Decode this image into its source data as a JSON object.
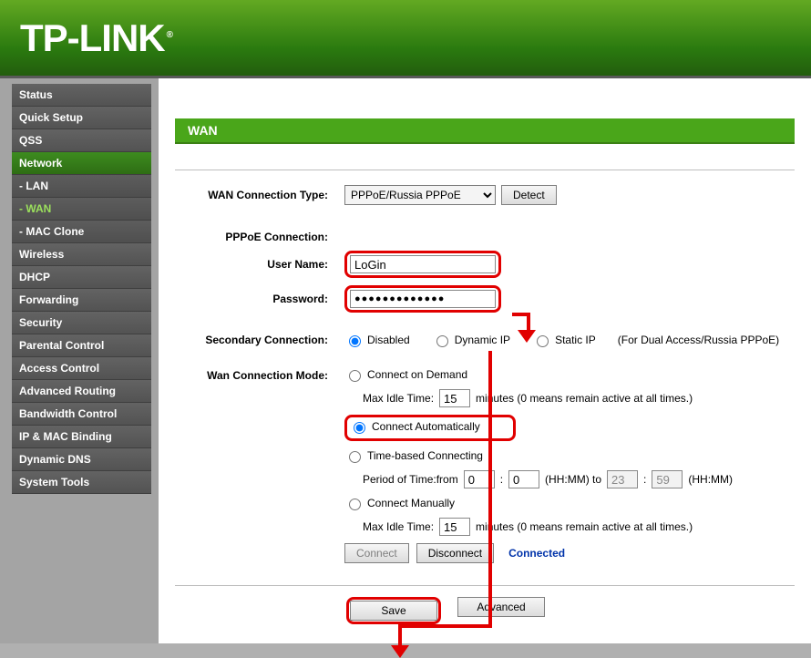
{
  "header": {
    "logo": "TP-LINK"
  },
  "sidebar": {
    "items": [
      {
        "label": "Status",
        "selected": false,
        "sub": false,
        "active": false
      },
      {
        "label": "Quick Setup",
        "selected": false,
        "sub": false,
        "active": false
      },
      {
        "label": "QSS",
        "selected": false,
        "sub": false,
        "active": false
      },
      {
        "label": "Network",
        "selected": true,
        "sub": false,
        "active": false
      },
      {
        "label": "- LAN",
        "selected": false,
        "sub": true,
        "active": false
      },
      {
        "label": "- WAN",
        "selected": false,
        "sub": true,
        "active": true
      },
      {
        "label": "- MAC Clone",
        "selected": false,
        "sub": true,
        "active": false
      },
      {
        "label": "Wireless",
        "selected": false,
        "sub": false,
        "active": false
      },
      {
        "label": "DHCP",
        "selected": false,
        "sub": false,
        "active": false
      },
      {
        "label": "Forwarding",
        "selected": false,
        "sub": false,
        "active": false
      },
      {
        "label": "Security",
        "selected": false,
        "sub": false,
        "active": false
      },
      {
        "label": "Parental Control",
        "selected": false,
        "sub": false,
        "active": false
      },
      {
        "label": "Access Control",
        "selected": false,
        "sub": false,
        "active": false
      },
      {
        "label": "Advanced Routing",
        "selected": false,
        "sub": false,
        "active": false
      },
      {
        "label": "Bandwidth Control",
        "selected": false,
        "sub": false,
        "active": false
      },
      {
        "label": "IP & MAC Binding",
        "selected": false,
        "sub": false,
        "active": false
      },
      {
        "label": "Dynamic DNS",
        "selected": false,
        "sub": false,
        "active": false
      },
      {
        "label": "System Tools",
        "selected": false,
        "sub": false,
        "active": false
      }
    ]
  },
  "panel": {
    "title": "WAN"
  },
  "wan": {
    "conn_type_label": "WAN Connection Type:",
    "conn_type_value": "PPPoE/Russia PPPoE",
    "detect_btn": "Detect",
    "pppoe_label": "PPPoE Connection:",
    "user_label": "User Name:",
    "user_value": "LoGin",
    "pass_label": "Password:",
    "pass_value": "●●●●●●●●●●●●●",
    "secondary_label": "Secondary Connection:",
    "sec_disabled": "Disabled",
    "sec_dynamic": "Dynamic IP",
    "sec_static": "Static IP",
    "sec_hint": "(For Dual Access/Russia PPPoE)",
    "mode_label": "Wan Connection Mode:",
    "mode_demand": "Connect on Demand",
    "idle_label": "Max Idle Time:",
    "idle_value": "15",
    "idle_hint": "minutes (0 means remain active at all times.)",
    "mode_auto": "Connect Automatically",
    "mode_time": "Time-based Connecting",
    "period_label": "Period of Time:from",
    "period_from_h": "0",
    "period_from_m": "0",
    "period_hhmm": "(HH:MM) to",
    "period_to_h": "23",
    "period_to_m": "59",
    "period_hhmm2": "(HH:MM)",
    "mode_manual": "Connect Manually",
    "idle2_value": "15",
    "connect_btn": "Connect",
    "disconnect_btn": "Disconnect",
    "status": "Connected",
    "save_btn": "Save",
    "advanced_btn": "Advanced",
    "colon": ":"
  }
}
